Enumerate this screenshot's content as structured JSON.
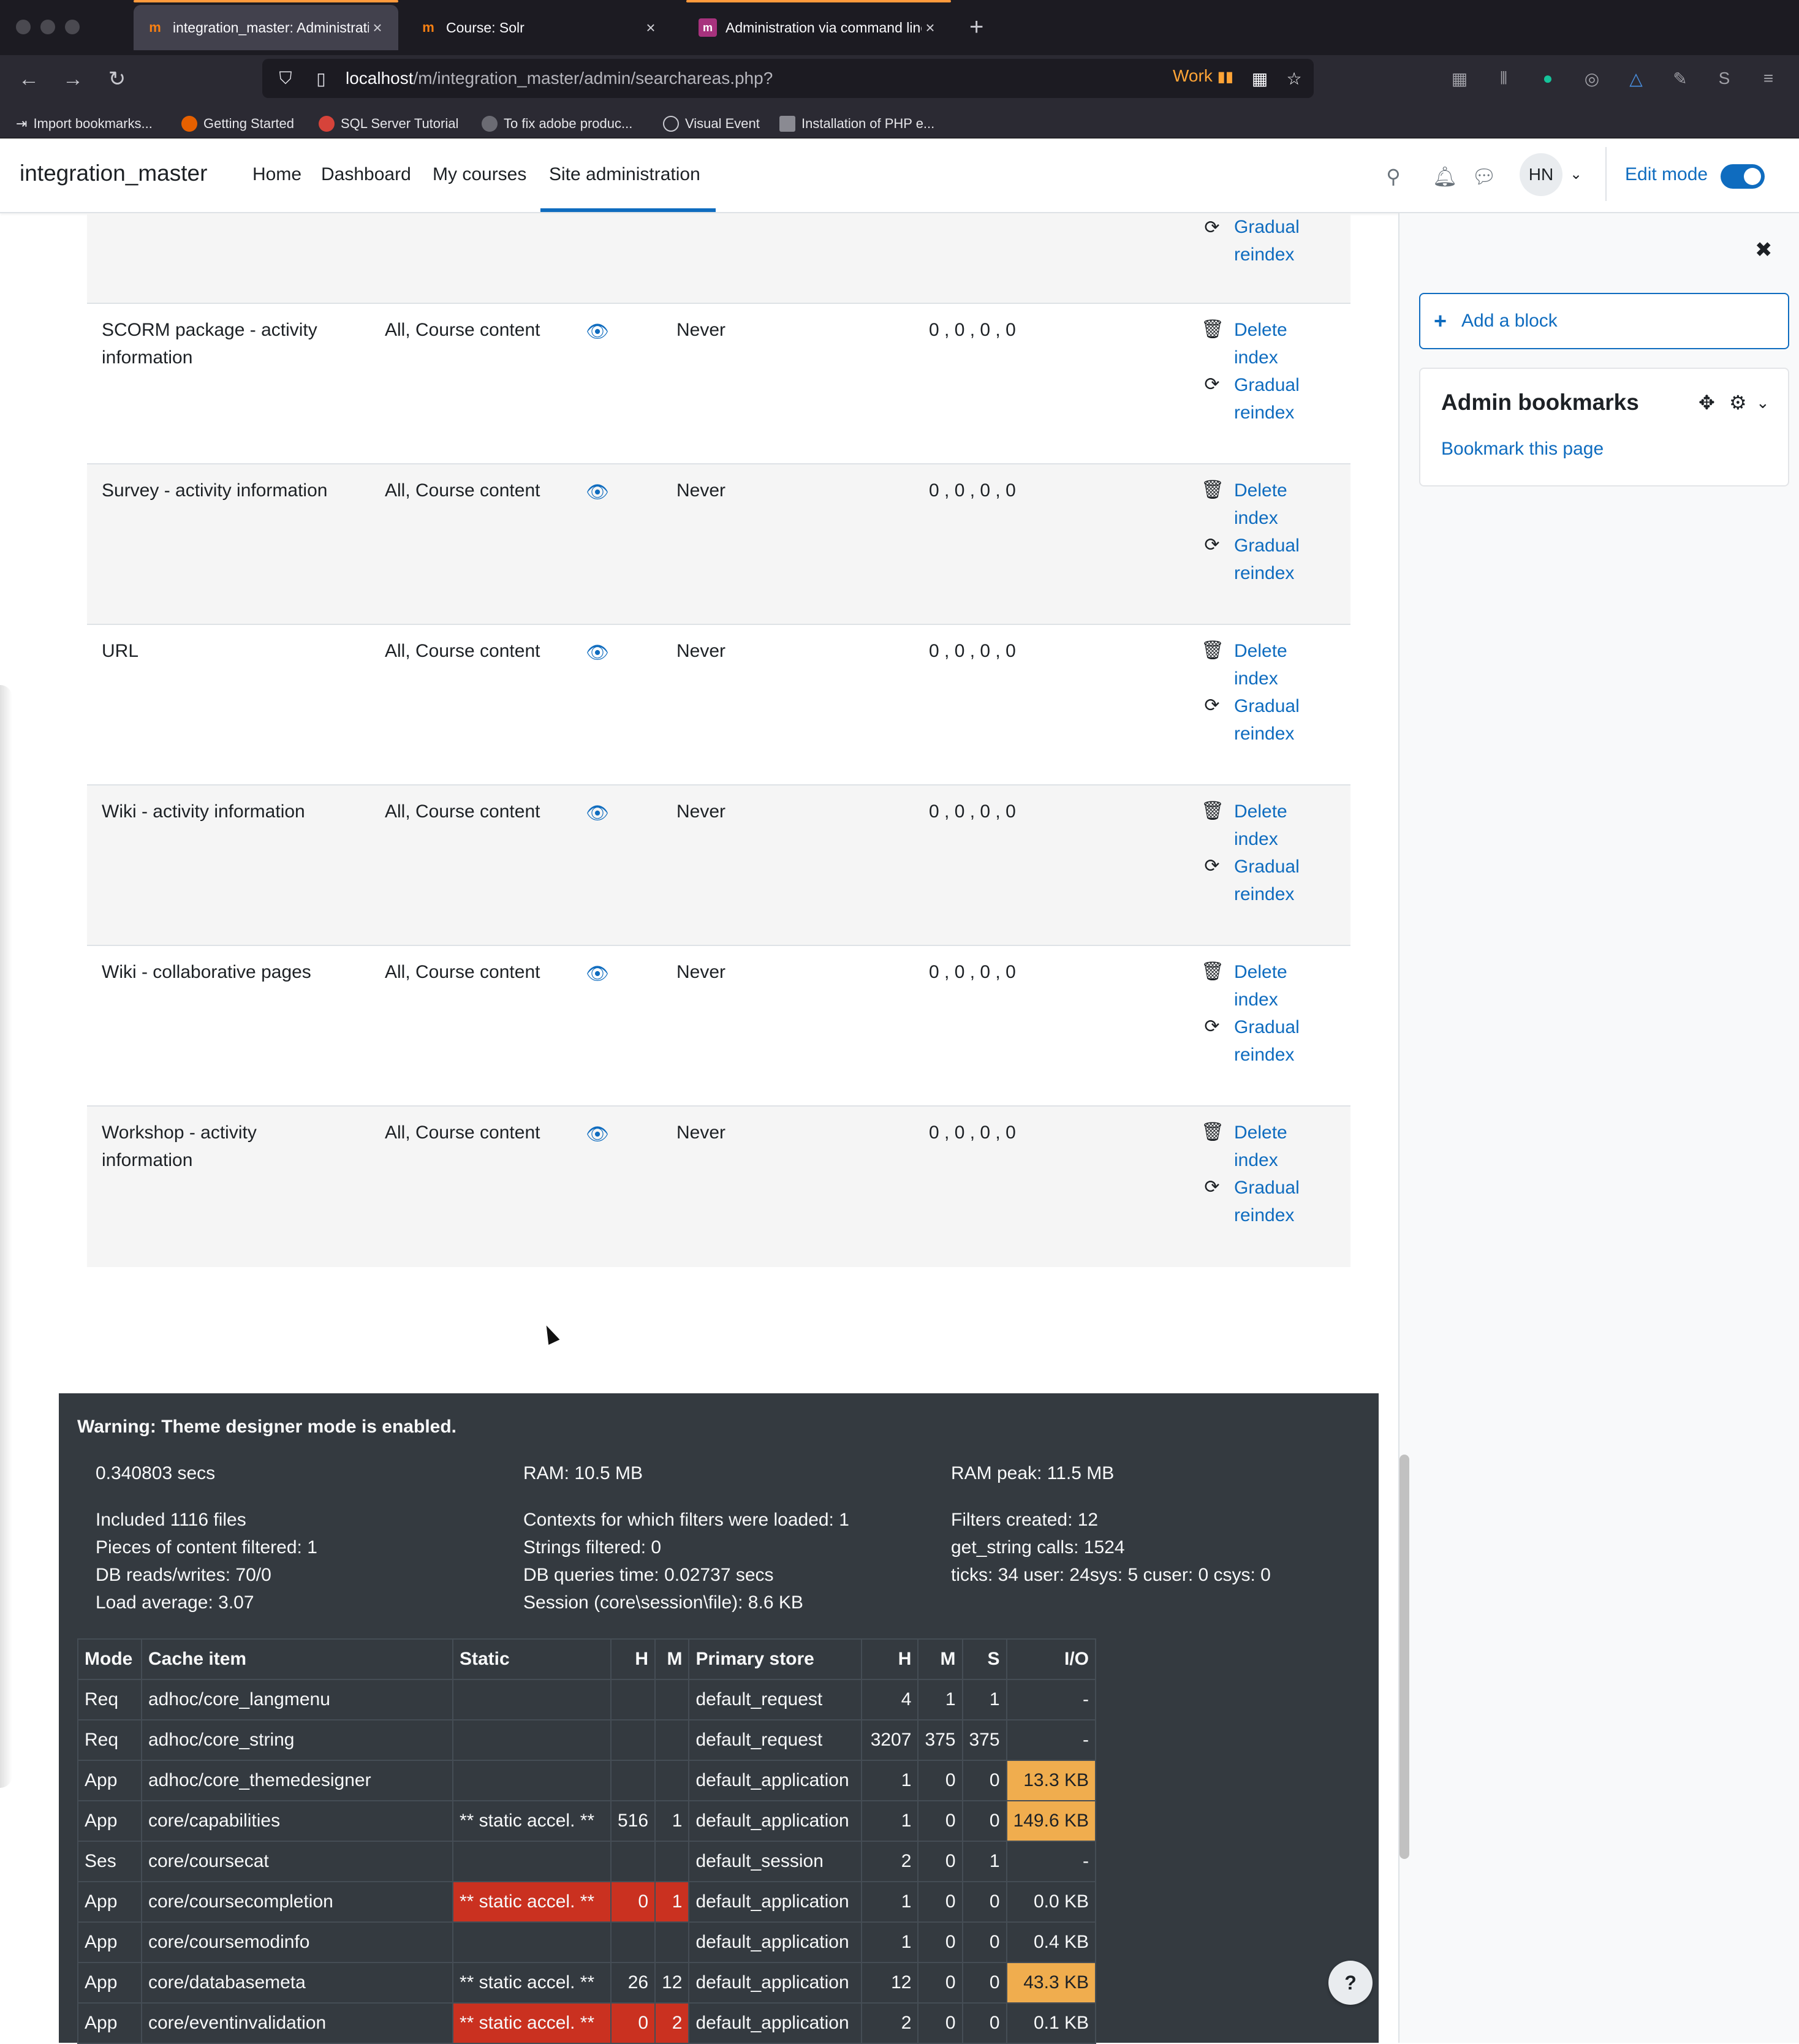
{
  "browser": {
    "tabs": [
      {
        "title": "integration_master: Administrati",
        "active": true
      },
      {
        "title": "Course: Solr",
        "active": false
      },
      {
        "title": "Administration via command line",
        "active": false
      }
    ],
    "url_host": "localhost",
    "url_path": "/m/integration_master/admin/searchareas.php?",
    "work_label": "Work",
    "bookmarks": [
      "Import bookmarks...",
      "Getting Started",
      "SQL Server Tutorial",
      "To fix adobe produc...",
      "Visual Event",
      "Installation of PHP e..."
    ]
  },
  "navbar": {
    "site_name": "integration_master",
    "primary": [
      "Home",
      "Dashboard",
      "My courses",
      "Site administration"
    ],
    "avatar_initials": "HN",
    "edit_mode_label": "Edit mode"
  },
  "search_areas": {
    "top_partial": {
      "action2": "Gradual",
      "action2b": "reindex"
    },
    "rows": [
      {
        "name_line1": "SCORM package - activity",
        "name_line2": "information",
        "category": "All, Course content",
        "last_indexed": "Never",
        "counts": "0 , 0 , 0 , 0",
        "delete1": "Delete",
        "delete2": "index",
        "reindex1": "Gradual",
        "reindex2": "reindex"
      },
      {
        "name_line1": "Survey - activity information",
        "name_line2": "",
        "category": "All, Course content",
        "last_indexed": "Never",
        "counts": "0 , 0 , 0 , 0",
        "delete1": "Delete",
        "delete2": "index",
        "reindex1": "Gradual",
        "reindex2": "reindex"
      },
      {
        "name_line1": "URL",
        "name_line2": "",
        "category": "All, Course content",
        "last_indexed": "Never",
        "counts": "0 , 0 , 0 , 0",
        "delete1": "Delete",
        "delete2": "index",
        "reindex1": "Gradual",
        "reindex2": "reindex"
      },
      {
        "name_line1": "Wiki - activity information",
        "name_line2": "",
        "category": "All, Course content",
        "last_indexed": "Never",
        "counts": "0 , 0 , 0 , 0",
        "delete1": "Delete",
        "delete2": "index",
        "reindex1": "Gradual",
        "reindex2": "reindex"
      },
      {
        "name_line1": "Wiki - collaborative pages",
        "name_line2": "",
        "category": "All, Course content",
        "last_indexed": "Never",
        "counts": "0 , 0 , 0 , 0",
        "delete1": "Delete",
        "delete2": "index",
        "reindex1": "Gradual",
        "reindex2": "reindex"
      },
      {
        "name_line1": "Workshop - activity",
        "name_line2": "information",
        "category": "All, Course content",
        "last_indexed": "Never",
        "counts": "0 , 0 , 0 , 0",
        "delete1": "Delete",
        "delete2": "index",
        "reindex1": "Gradual",
        "reindex2": "reindex"
      }
    ]
  },
  "perf": {
    "warning": "Warning: Theme designer mode is enabled.",
    "secs": "0.340803 secs",
    "ram": "RAM: 10.5 MB",
    "ram_peak": "RAM peak: 11.5 MB",
    "col1": [
      "Included 1116 files",
      "Pieces of content filtered: 1",
      "DB reads/writes: 70/0",
      "Load average: 3.07"
    ],
    "col2": [
      "Contexts for which filters were loaded: 1",
      "Strings filtered: 0",
      "DB queries time: 0.02737 secs",
      "Session (core\\session\\file): 8.6 KB"
    ],
    "col3": [
      "Filters created: 12",
      "get_string calls: 1524",
      "ticks: 34 user: 24sys: 5 cuser: 0 csys: 0"
    ],
    "cache_headers": [
      "Mode",
      "Cache item",
      "Static",
      "H",
      "M",
      "Primary store",
      "H",
      "M",
      "S",
      "I/O"
    ],
    "cache_rows": [
      [
        "Req",
        "adhoc/core_langmenu",
        "",
        "",
        "",
        "default_request",
        "4",
        "1",
        "1",
        "-"
      ],
      [
        "Req",
        "adhoc/core_string",
        "",
        "",
        "",
        "default_request",
        "3207",
        "375",
        "375",
        "-"
      ],
      [
        "App",
        "adhoc/core_themedesigner",
        "",
        "",
        "",
        "default_application",
        "1",
        "0",
        "0",
        "13.3 KB"
      ],
      [
        "App",
        "core/capabilities",
        "** static accel. **",
        "516",
        "1",
        "default_application",
        "1",
        "0",
        "0",
        "149.6 KB"
      ],
      [
        "Ses",
        "core/coursecat",
        "",
        "",
        "",
        "default_session",
        "2",
        "0",
        "1",
        "-"
      ],
      [
        "App",
        "core/coursecompletion",
        "** static accel. **",
        "0",
        "1",
        "default_application",
        "1",
        "0",
        "0",
        "0.0 KB"
      ],
      [
        "App",
        "core/coursemodinfo",
        "",
        "",
        "",
        "default_application",
        "1",
        "0",
        "0",
        "0.4 KB"
      ],
      [
        "App",
        "core/databasemeta",
        "** static accel. **",
        "26",
        "12",
        "default_application",
        "12",
        "0",
        "0",
        "43.3 KB"
      ],
      [
        "App",
        "core/eventinvalidation",
        "** static accel. **",
        "0",
        "2",
        "default_application",
        "2",
        "0",
        "0",
        "0.1 KB"
      ]
    ],
    "red_cells": [
      [
        5,
        2
      ],
      [
        5,
        3
      ],
      [
        5,
        4
      ],
      [
        8,
        2
      ],
      [
        8,
        3
      ],
      [
        8,
        4
      ]
    ],
    "orange_cells": [
      [
        2,
        9
      ],
      [
        3,
        9
      ],
      [
        7,
        9
      ]
    ]
  },
  "drawer": {
    "add_block_label": "Add a block",
    "bookmarks_title": "Admin bookmarks",
    "bookmark_link": "Bookmark this page"
  },
  "help_label": "?"
}
